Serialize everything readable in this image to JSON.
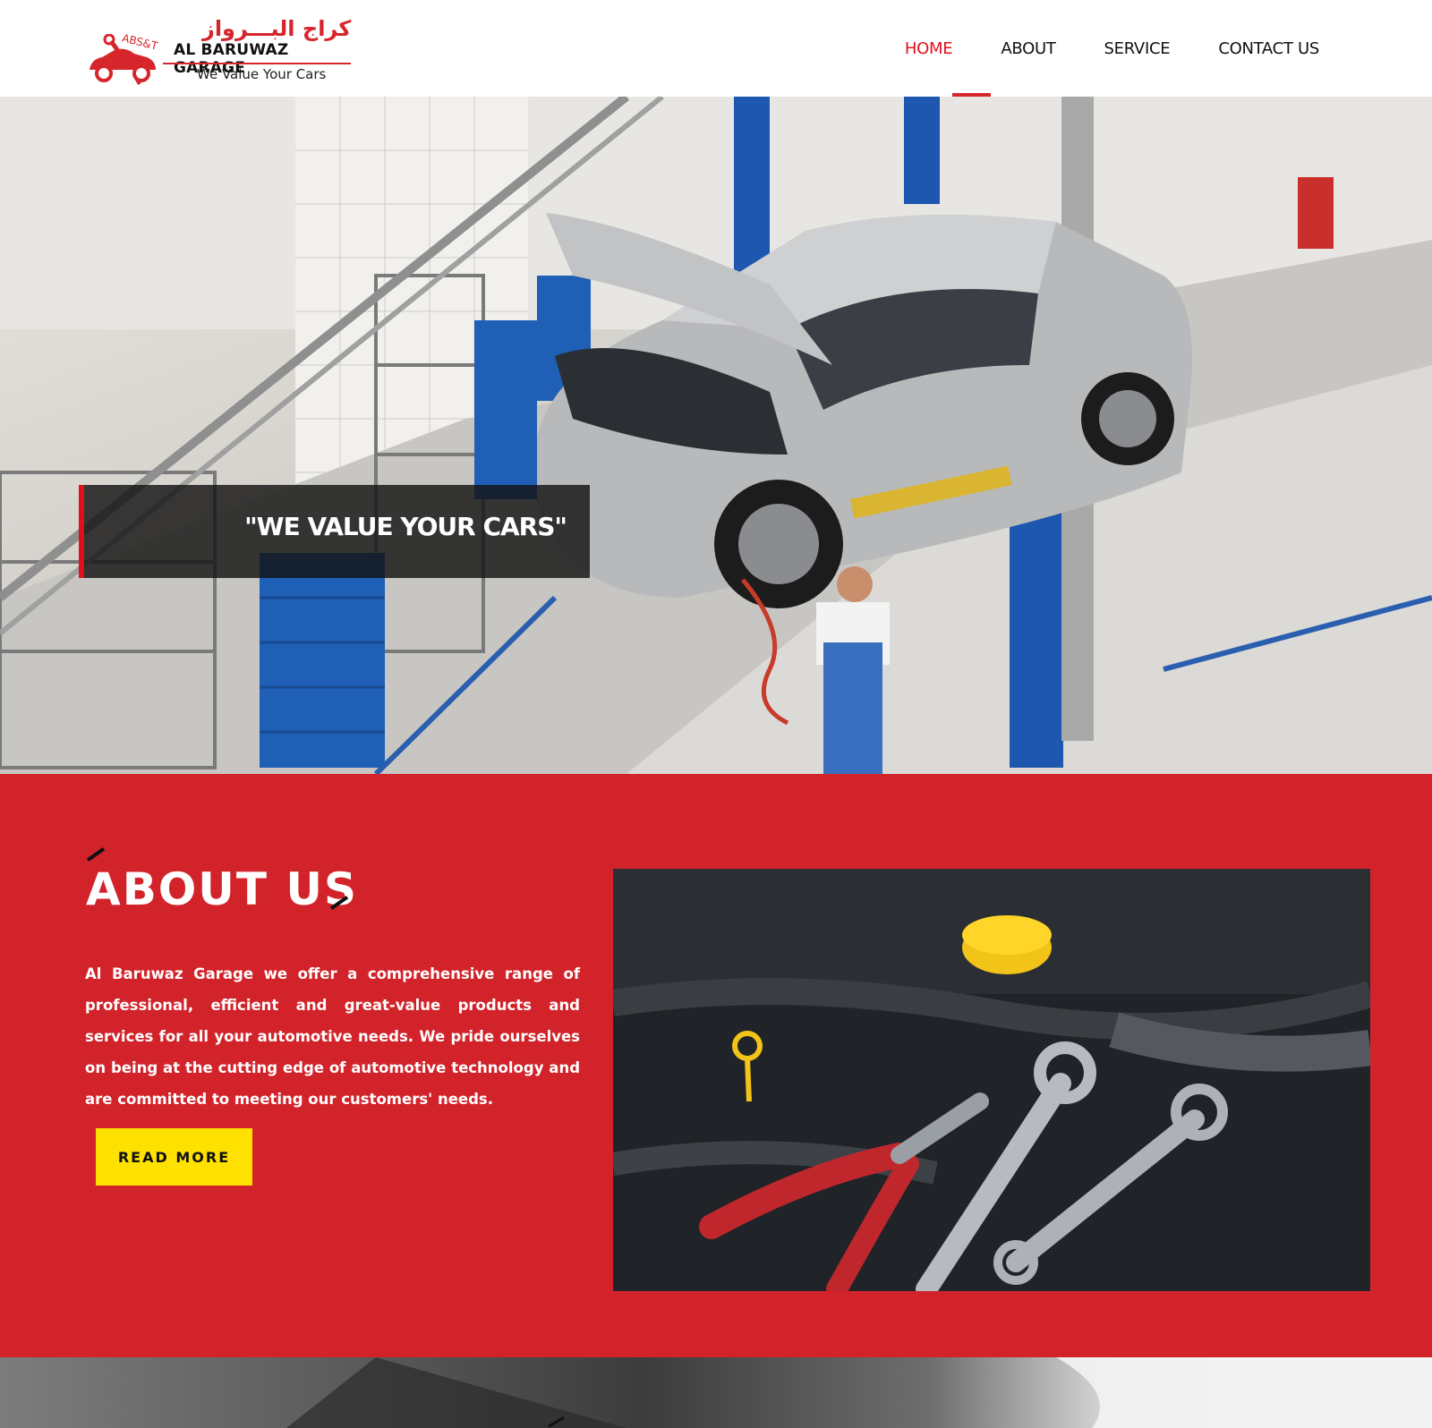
{
  "brand": {
    "arabic_name": "كراج البـــرواز",
    "badge": "ABS&T",
    "name": "AL BARUWAZ GARAGE",
    "tagline": "We Value Your Cars",
    "accent_color": "#d3232a"
  },
  "nav": {
    "items": [
      {
        "label": "HOME",
        "active": true
      },
      {
        "label": "ABOUT",
        "active": false
      },
      {
        "label": "SERVICE",
        "active": false
      },
      {
        "label": "CONTACT US",
        "active": false
      }
    ]
  },
  "hero": {
    "caption": "\"WE VALUE YOUR CARS\"",
    "slides_count": 3,
    "active_slide": 2,
    "image": "mechanic-repairing-suv-wheel-in-garage"
  },
  "about": {
    "title": "ABOUT US",
    "body": "Al Baruwaz Garage we offer a comprehensive range of professional, efficient and great-value products and services for all your automotive needs. We pride ourselves on being at the cutting edge of automotive technology and are committed to meeting our customers' needs.",
    "button_label": "READ MORE",
    "button_color": "#ffe100",
    "image": "engine-bay-with-wrenches-and-pliers"
  }
}
